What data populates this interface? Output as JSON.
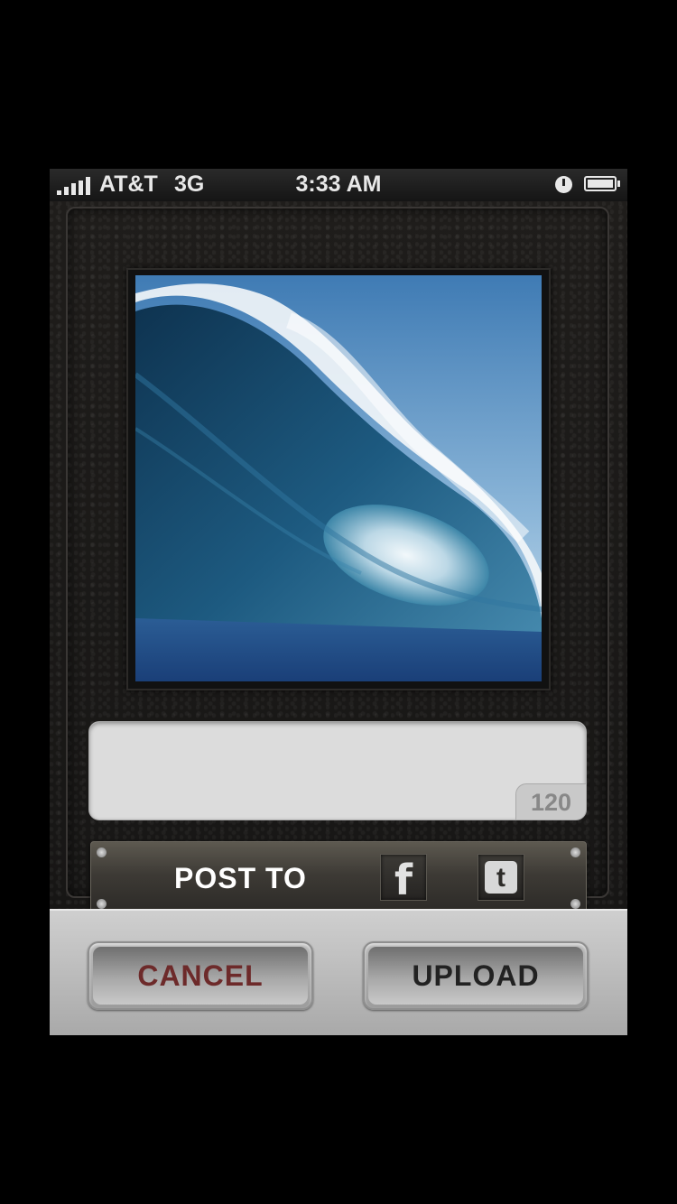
{
  "status_bar": {
    "carrier": "AT&T",
    "network": "3G",
    "time": "3:33 AM",
    "signal_bars": 5,
    "battery_level": 0.95
  },
  "photo": {
    "icon": "wave-photo"
  },
  "caption": {
    "value": "",
    "counter": "120"
  },
  "post_to": {
    "label": "POST TO",
    "facebook_icon": "facebook-icon",
    "facebook_glyph": "f",
    "twitter_icon": "twitter-icon",
    "twitter_glyph": "t"
  },
  "toolbar": {
    "cancel_label": "CANCEL",
    "upload_label": "UPLOAD"
  },
  "colors": {
    "cancel_text": "#6d2a2a",
    "caption_bg": "#dcdcdc",
    "toolbar_bg": "#bdbdbd"
  }
}
